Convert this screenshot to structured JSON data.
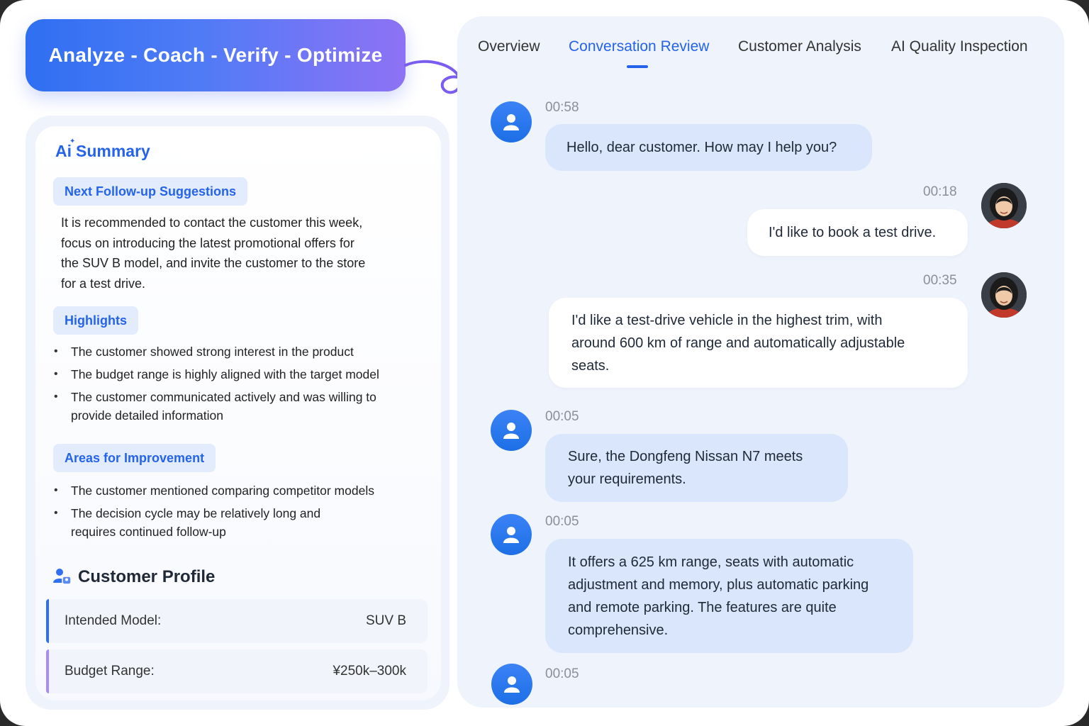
{
  "banner": {
    "text": "Analyze - Coach - Verify - Optimize"
  },
  "summary": {
    "title": "Summary",
    "ai_mark": "Ai",
    "next_followup": {
      "label": "Next Follow-up Suggestions",
      "text": "It is recommended to contact the customer this week, focus on introducing the latest promotional offers for the SUV B model, and invite the customer to the store for a test drive."
    },
    "highlights": {
      "label": "Highlights",
      "items": [
        "The customer showed strong interest in the product",
        "The budget range is highly aligned with the target model",
        "The customer communicated actively and was willing to provide detailed information"
      ]
    },
    "improvement": {
      "label": "Areas for Improvement",
      "items": [
        "The customer mentioned comparing competitor models",
        "The decision cycle may be relatively long and requires continued follow-up"
      ]
    }
  },
  "profile": {
    "title": "Customer Profile",
    "rows": [
      {
        "label": "Intended Model:",
        "value": "SUV B",
        "accent": "#2f6ff2"
      },
      {
        "label": "Budget Range:",
        "value": "¥250k–300k",
        "accent": "#a78bfa"
      }
    ]
  },
  "tabs": [
    {
      "label": "Overview",
      "active": false
    },
    {
      "label": "Conversation Review",
      "active": true
    },
    {
      "label": "Customer Analysis",
      "active": false
    },
    {
      "label": "AI Quality Inspection",
      "active": false
    }
  ],
  "messages": [
    {
      "from": "agent",
      "time": "00:58",
      "text": "Hello, dear customer. How may I help you?"
    },
    {
      "from": "customer",
      "time": "00:18",
      "text": "I'd like to book a test drive."
    },
    {
      "from": "customer",
      "time": "00:35",
      "text": "I'd like a test-drive vehicle in the highest trim, with around 600 km of range and automatically adjustable seats."
    },
    {
      "from": "agent",
      "time": "00:05",
      "text": "Sure, the Dongfeng Nissan N7 meets your requirements."
    },
    {
      "from": "agent",
      "time": "00:05",
      "text": "It offers a 625 km range, seats with automatic adjustment and memory, plus automatic parking and remote parking. The features are quite comprehensive."
    },
    {
      "from": "agent",
      "time": "00:05",
      "text": ""
    }
  ],
  "icons": {
    "agent_avatar": "user-icon",
    "profile": "users-icon",
    "connector": "squiggle-connector"
  },
  "colors": {
    "primary": "#2563eb",
    "banner_start": "#2f6ff2",
    "banner_end": "#8e72f5",
    "panel_bg": "#eef3fc",
    "agent_bubble": "#d9e6fb"
  }
}
